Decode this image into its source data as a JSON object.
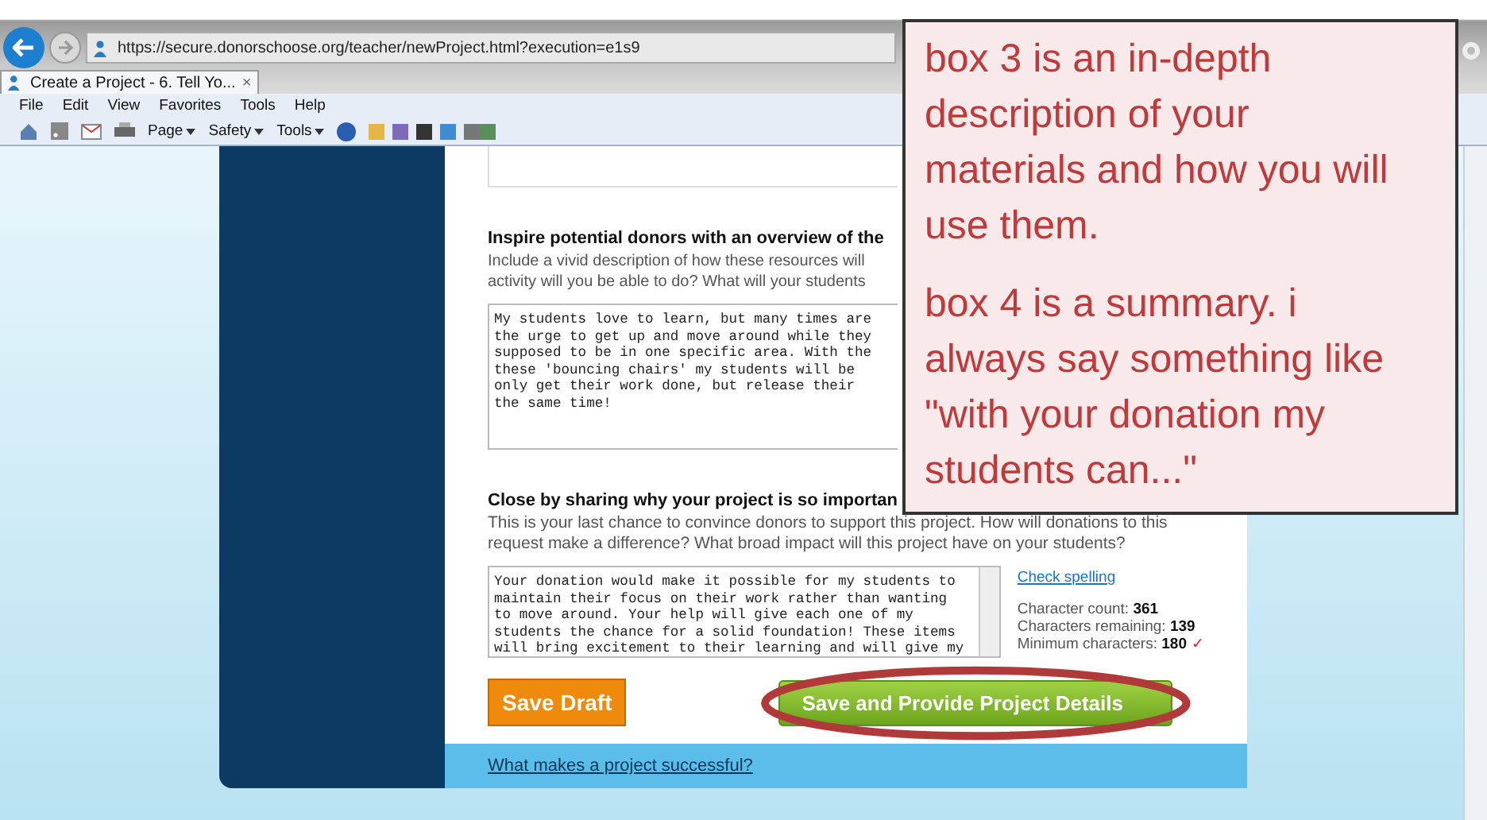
{
  "browser": {
    "address": "https://secure.donorschoose.org/teacher/newProject.html?execution=e1s9",
    "tab": {
      "title": "Create a Project - 6. Tell Yo...",
      "close": "×"
    },
    "menu": [
      "File",
      "Edit",
      "View",
      "Favorites",
      "Tools",
      "Help"
    ],
    "command_menus": [
      "Page",
      "Safety",
      "Tools"
    ]
  },
  "sections": [
    {
      "heading": "Inspire potential donors with an overview of the",
      "description_lines": [
        "Include a vivid description of how these resources will",
        "activity will you be able to do? What will your students"
      ],
      "text_lines": [
        "My students love to learn, but many times are",
        "the urge to get up and move around while they",
        "supposed to be in one specific area. With the",
        "these 'bouncing chairs' my students will be",
        "only get their work done, but release their",
        "the same time!"
      ]
    },
    {
      "heading": "Close by sharing why your project is so importan",
      "description": "This is your last chance to convince donors to support this project. How will donations to this request make a difference? What broad impact will this project have on your students?",
      "text_lines": [
        "Your donation would make it possible for my students to",
        "maintain their focus on their work rather than wanting",
        "to move around. Your help will give each one of my",
        "students the chance for a solid foundation! These items",
        "will bring excitement to their learning and will give my"
      ],
      "check_spelling": "Check spelling",
      "stats": [
        {
          "label": "Character count:",
          "value": "361"
        },
        {
          "label": "Characters remaining:",
          "value": "139"
        },
        {
          "label": "Minimum characters:",
          "value": "180",
          "mark": "✓"
        }
      ]
    }
  ],
  "buttons": {
    "save_draft": "Save Draft",
    "save_continue": "Save and Provide Project Details"
  },
  "footer_link": "What makes a project successful?",
  "note": {
    "paragraphs": [
      "box 3 is an in-depth description of your materials and how you will use them.",
      "box 4 is a summary. i always say something like \"with your donation my students can...\""
    ]
  }
}
